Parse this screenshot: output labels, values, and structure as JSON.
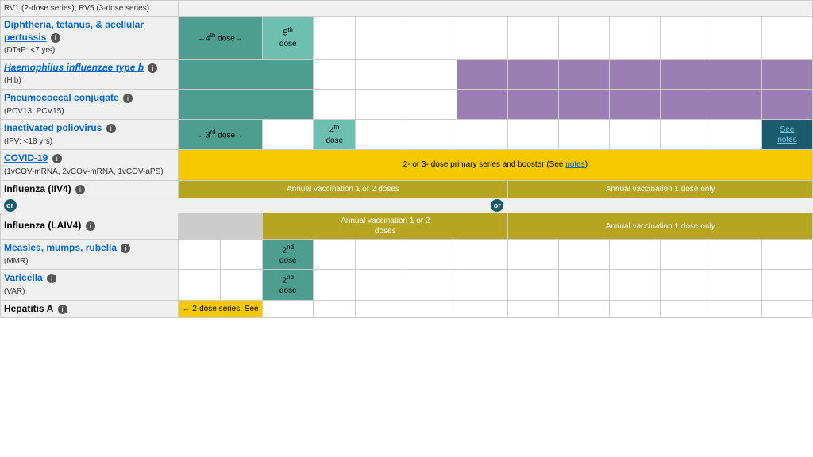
{
  "vaccines": [
    {
      "id": "rotavirus",
      "name": "",
      "sub": "RV1 (2-dose series); RV5 (3-dose series)",
      "link": false,
      "cells": [
        "text",
        "",
        "",
        "",
        "",
        "",
        "",
        "",
        "",
        "",
        "",
        "",
        "",
        ""
      ]
    },
    {
      "id": "dtap",
      "name": "Diphtheria, tetanus, & acellular pertussis",
      "sub": "(DTaP: <7 yrs)",
      "link": true,
      "info": true,
      "cells": [
        "vaccine",
        "←4th dose→",
        "",
        "5th dose",
        "",
        "",
        "",
        "",
        "",
        "",
        "",
        "",
        "",
        ""
      ]
    },
    {
      "id": "hib",
      "name": "Haemophilus influenzae type b",
      "sub": "(Hib)",
      "link": true,
      "italic": true,
      "info": true,
      "cells": [
        "vaccine",
        "filled",
        "",
        "",
        "",
        "",
        "",
        "purple",
        "purple",
        "purple",
        "purple",
        "purple",
        "purple",
        "purple"
      ]
    },
    {
      "id": "pcv",
      "name": "Pneumococcal conjugate",
      "sub": "(PCV13, PCV15)",
      "link": true,
      "info": true,
      "cells": [
        "vaccine",
        "filled",
        "",
        "",
        "",
        "",
        "",
        "purple",
        "purple",
        "purple",
        "purple",
        "purple",
        "purple",
        "purple"
      ]
    },
    {
      "id": "ipv",
      "name": "Inactivated poliovirus",
      "sub": "(IPV: <18 yrs)",
      "link": true,
      "info": true,
      "cells": [
        "vaccine",
        "←3rd dose→",
        "",
        "4th dose",
        "",
        "",
        "",
        "",
        "",
        "",
        "",
        "",
        "",
        "See notes"
      ]
    },
    {
      "id": "covid",
      "name": "COVID-19",
      "sub": "(1vCOV-mRNA, 2vCOV-mRNA, 1vCOV-aPS)",
      "link": true,
      "info": true,
      "cells": [
        "vaccine",
        "2- or 3- dose primary series and booster (See notes)"
      ]
    },
    {
      "id": "influenza-iiv4",
      "name": "Influenza (IIV4)",
      "link": false,
      "info": true,
      "cells": [
        "vaccine",
        "Annual vaccination 1 or 2 doses",
        "Annual vaccination 1 dose only"
      ]
    },
    {
      "id": "influenza-laiv4",
      "name": "Influenza (LAIV4)",
      "link": false,
      "info": true,
      "cells": [
        "vaccine",
        "gray",
        "gray",
        "Annual vaccination 1 or 2 doses",
        "Annual vaccination 1 dose only"
      ]
    },
    {
      "id": "mmr",
      "name": "Measles, mumps, rubella",
      "sub": "(MMR)",
      "link": true,
      "info": true,
      "cells": [
        "vaccine",
        "",
        "",
        "2nd dose",
        "",
        "",
        "",
        "",
        "",
        "",
        "",
        "",
        "",
        ""
      ]
    },
    {
      "id": "varicella",
      "name": "Varicella",
      "sub": "(VAR)",
      "link": true,
      "info": true,
      "cells": [
        "vaccine",
        "",
        "",
        "2nd dose",
        "",
        "",
        "",
        "",
        "",
        "",
        "",
        "",
        "",
        ""
      ]
    },
    {
      "id": "hepa",
      "name": "Hepatitis A",
      "link": false,
      "info": true,
      "cells": [
        "vaccine",
        "← 2-dose series, See",
        "",
        "",
        "",
        "",
        "",
        "",
        "",
        "",
        "",
        "",
        "",
        ""
      ]
    }
  ],
  "or_label": "or",
  "notes_label": "notes"
}
